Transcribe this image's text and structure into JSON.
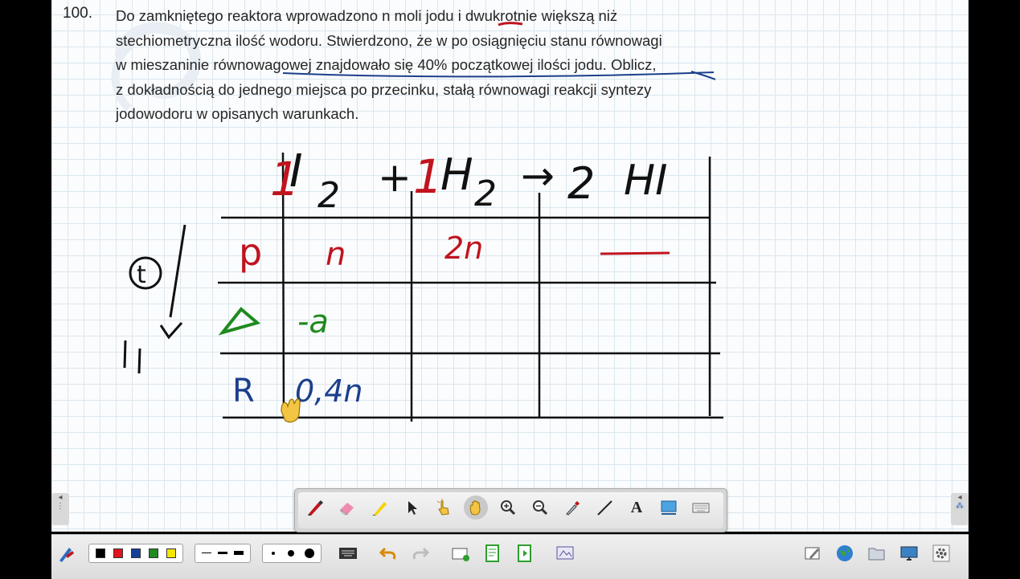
{
  "problem": {
    "number": "100.",
    "lines": [
      "Do zamkniętego reaktora wprowadzono n moli jodu i dwukrotnie większą niż",
      "stechiometryczna ilość wodoru. Stwierdzono, że w po osiągnięciu stanu równowagi",
      "w mieszaninie równowagowej znajdowało się 40% początkowej ilości jodu. Oblicz,",
      "z dokładnością do jednego miejsca po przecinku, stałą równowagi reakcji syntezy",
      "jodowodoru w opisanych warunkach."
    ]
  },
  "handwriting": {
    "equation": {
      "coef_i2": "1",
      "i2": "I",
      "sub_i2": "2",
      "plus": "+",
      "coef_h2": "1",
      "h2": "H",
      "sub_h2": "2",
      "arrow": "→",
      "coef_hi": "2",
      "hi": "HI"
    },
    "side_t": "t",
    "side_mark": "I I",
    "rows": [
      {
        "label": "p",
        "i2": "n",
        "h2": "2n",
        "hi": "—"
      },
      {
        "label": "Δ",
        "i2": "-a",
        "h2": "",
        "hi": ""
      },
      {
        "label": "R",
        "i2": "0,4n",
        "h2": "",
        "hi": ""
      }
    ]
  },
  "colors": {
    "red": "#c0141e",
    "green": "#1f8a1f",
    "blue": "#1c3f8c",
    "black": "#111111"
  },
  "toolbar": {
    "tools": [
      "pen-icon",
      "eraser-icon",
      "highlighter-icon",
      "select-arrow-icon",
      "touch-hand-icon",
      "pan-hand-icon",
      "zoom-in-icon",
      "zoom-out-icon",
      "eyedropper-icon",
      "line-icon",
      "text-icon",
      "screen-capture-icon",
      "keyboard-icon"
    ],
    "text_tool_label": "A"
  },
  "bottom": {
    "pen_colors": [
      "#000000",
      "#e0141e",
      "#1a3f9a",
      "#1f8a1f",
      "#f5e600"
    ],
    "line_widths": [
      "thin",
      "medium",
      "thick"
    ],
    "dot_sizes": [
      "small",
      "medium",
      "large"
    ]
  }
}
